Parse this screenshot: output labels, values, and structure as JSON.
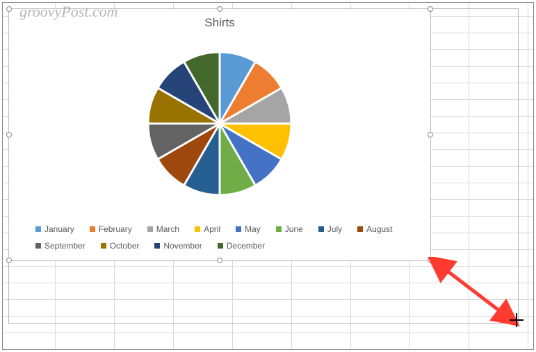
{
  "watermark": "groovyPost.com",
  "chart_data": {
    "type": "pie",
    "title": "Shirts",
    "categories": [
      "January",
      "February",
      "March",
      "April",
      "May",
      "June",
      "July",
      "August",
      "September",
      "October",
      "November",
      "December"
    ],
    "values": [
      1,
      1,
      1,
      1,
      1,
      1,
      1,
      1,
      1,
      1,
      1,
      1
    ],
    "series": [
      {
        "name": "January",
        "value": 1,
        "color": "#5b9bd5"
      },
      {
        "name": "February",
        "value": 1,
        "color": "#ed7d31"
      },
      {
        "name": "March",
        "value": 1,
        "color": "#a5a5a5"
      },
      {
        "name": "April",
        "value": 1,
        "color": "#ffc000"
      },
      {
        "name": "May",
        "value": 1,
        "color": "#4472c4"
      },
      {
        "name": "June",
        "value": 1,
        "color": "#70ad47"
      },
      {
        "name": "July",
        "value": 1,
        "color": "#255e91"
      },
      {
        "name": "August",
        "value": 1,
        "color": "#9e480e"
      },
      {
        "name": "September",
        "value": 1,
        "color": "#636363"
      },
      {
        "name": "October",
        "value": 1,
        "color": "#997300"
      },
      {
        "name": "November",
        "value": 1,
        "color": "#264478"
      },
      {
        "name": "December",
        "value": 1,
        "color": "#43682b"
      }
    ],
    "exploded": true,
    "legend_position": "bottom"
  }
}
